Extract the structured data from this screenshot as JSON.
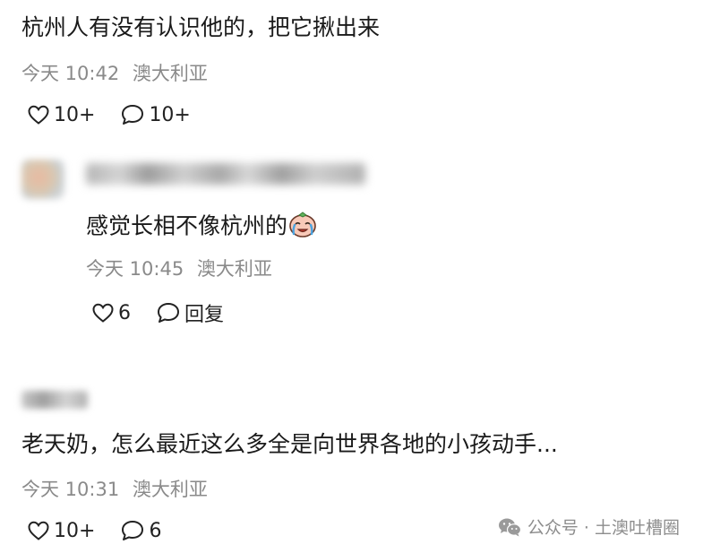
{
  "comments": [
    {
      "text": "杭州人有没有认识他的，把它揪出来",
      "time": "今天 10:42",
      "location": "澳大利亚",
      "likes": "10+",
      "replies": "10+"
    },
    {
      "text": "感觉长相不像杭州的",
      "time": "今天 10:45",
      "location": "澳大利亚",
      "likes": "6",
      "replies": "回复"
    },
    {
      "text": "老天奶，怎么最近这么多全是向世界各地的小孩动手...",
      "time": "今天 10:31",
      "location": "澳大利亚",
      "likes": "10+",
      "replies": "6"
    }
  ],
  "watermark": {
    "text": "公众号 · 土澳吐槽圈"
  }
}
